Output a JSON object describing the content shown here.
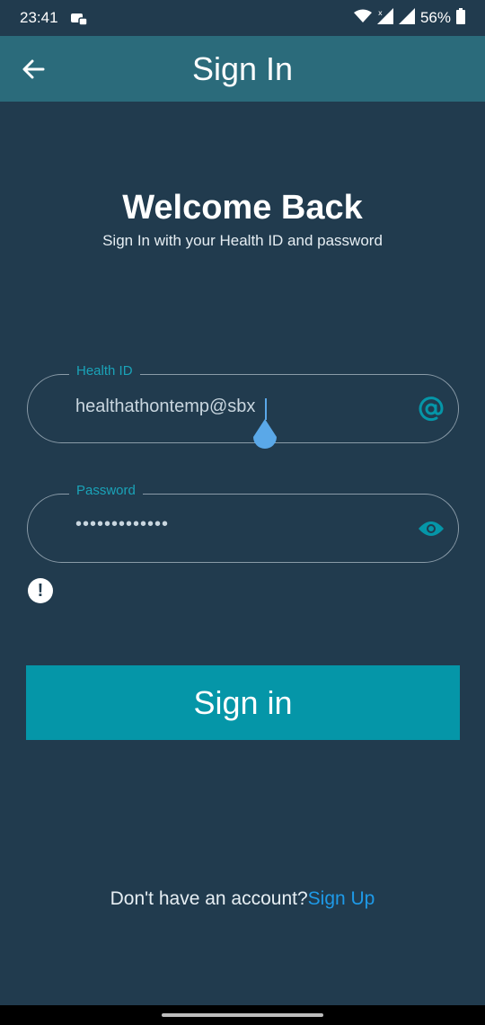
{
  "status_bar": {
    "time": "23:41",
    "battery": "56%"
  },
  "app_bar": {
    "title": "Sign In"
  },
  "welcome": {
    "heading": "Welcome Back",
    "subtitle": "Sign In with your Health ID and password"
  },
  "health_id_field": {
    "label": "Health ID",
    "value": "healthathontemp@sbx",
    "icon": "at-icon"
  },
  "password_field": {
    "label": "Password",
    "value": "•••••••••••••",
    "icon": "eye-icon"
  },
  "error_indicator": {
    "symbol": "!"
  },
  "sign_in_button": {
    "label": "Sign in"
  },
  "signup": {
    "prompt": "Don't have an account?",
    "link": "Sign Up"
  },
  "colors": {
    "background": "#213b4e",
    "app_bar": "#2b6b7b",
    "accent": "#0596a8",
    "link": "#1e9ae8"
  }
}
